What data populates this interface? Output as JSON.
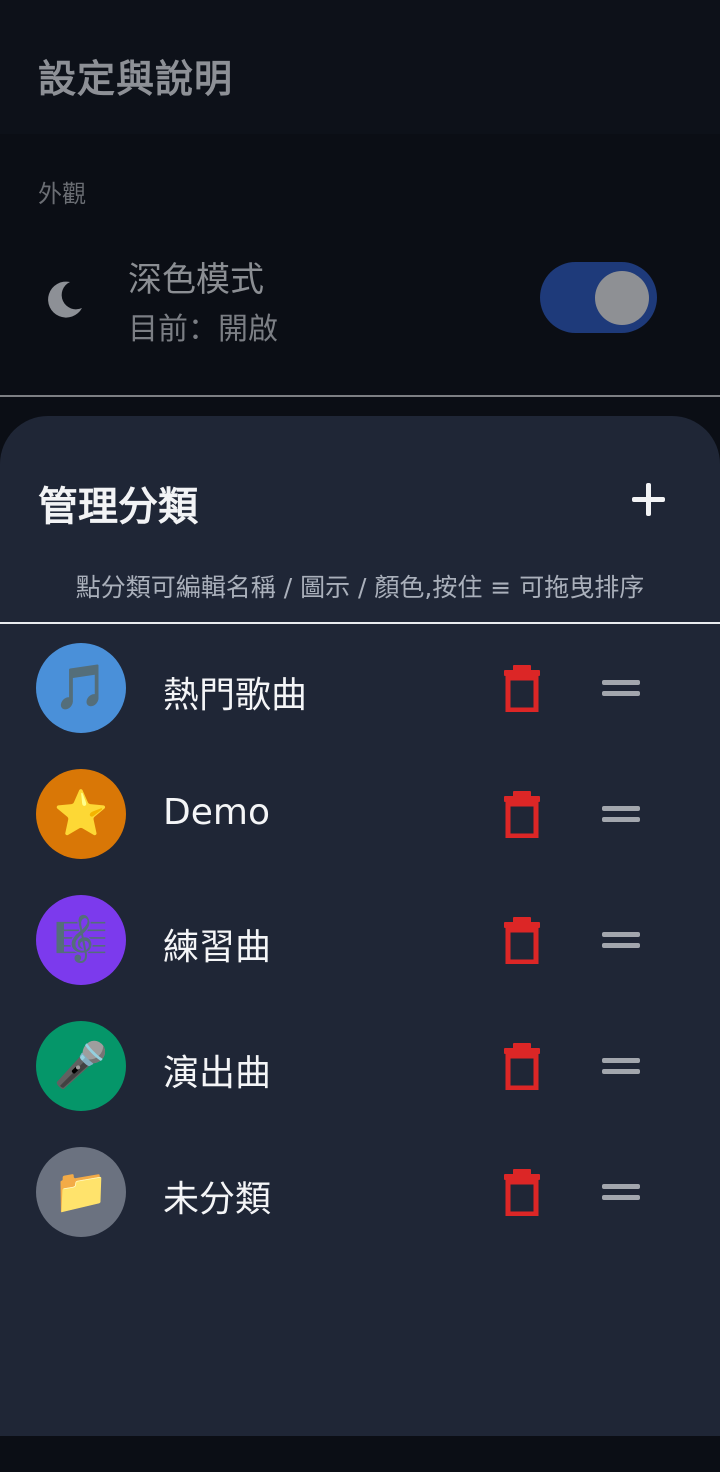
{
  "settings": {
    "title": "設定與說明",
    "section_appearance": "外觀",
    "dark_mode": {
      "label": "深色模式",
      "status": "目前：開啟",
      "enabled": true
    }
  },
  "sheet": {
    "title": "管理分類",
    "add_icon": "plus-icon",
    "hint": "點分類可編輯名稱 / 圖示 / 顏色,按住 ≡ 可拖曳排序",
    "categories": [
      {
        "name": "熱門歌曲",
        "emoji": "🎵",
        "color": "#4a90d9"
      },
      {
        "name": "Demo",
        "emoji": "⭐",
        "color": "#d97706"
      },
      {
        "name": "練習曲",
        "emoji": "🎼",
        "color": "#7c3aed"
      },
      {
        "name": "演出曲",
        "emoji": "🎤",
        "color": "#059669"
      },
      {
        "name": "未分類",
        "emoji": "📁",
        "color": "#6b7280"
      }
    ]
  },
  "colors": {
    "delete": "#dc2626",
    "toggle_on": "#1e3a7a",
    "sheet_bg": "#1f2636"
  }
}
